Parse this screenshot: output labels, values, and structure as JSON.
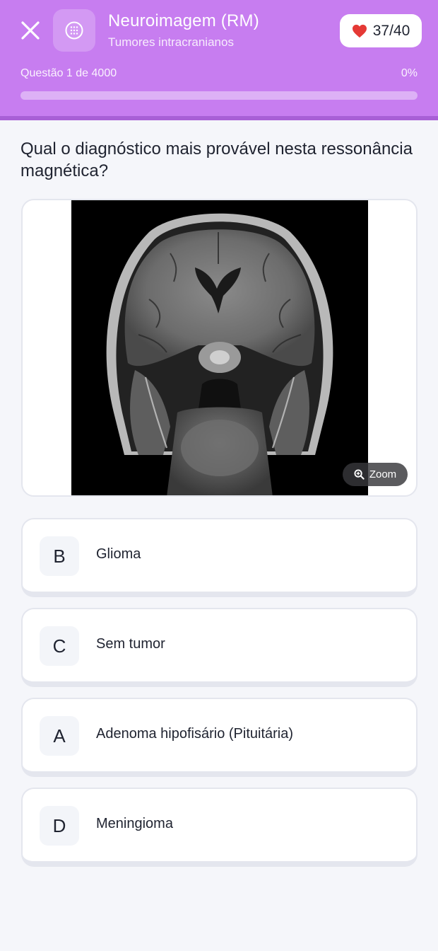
{
  "header": {
    "title": "Neuroimagem (RM)",
    "subtitle": "Tumores intracranianos",
    "lives": "37/40",
    "progress_label": "Questão 1 de 4000",
    "progress_percent": "0%",
    "progress_value": 0,
    "bg_color": "#c77df0",
    "close_icon": "close-icon",
    "topic_icon": "brain-icon",
    "lives_icon": "heart-icon",
    "heart_color": "#e53935"
  },
  "question": {
    "text": "Qual o diagnóstico mais provável nesta ressonância magnética?"
  },
  "image": {
    "zoom_label": "Zoom",
    "zoom_icon": "zoom-in-icon"
  },
  "options": [
    {
      "letter": "B",
      "text": "Glioma"
    },
    {
      "letter": "C",
      "text": "Sem tumor"
    },
    {
      "letter": "A",
      "text": "Adenoma hipofisário (Pituitária)"
    },
    {
      "letter": "D",
      "text": "Meningioma"
    }
  ]
}
